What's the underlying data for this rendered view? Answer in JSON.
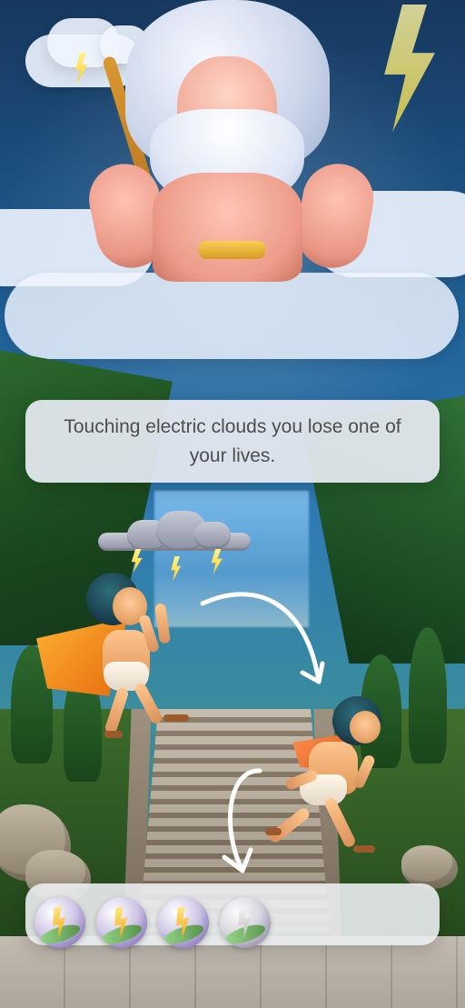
{
  "tutorial": {
    "message": "Touching electric clouds you lose one of your lives."
  },
  "hud": {
    "lives": [
      {
        "state": "full",
        "icon": "life-bolt-icon"
      },
      {
        "state": "full",
        "icon": "life-bolt-icon"
      },
      {
        "state": "full",
        "icon": "life-bolt-icon"
      },
      {
        "state": "used",
        "icon": "life-bolt-icon"
      }
    ]
  },
  "scene": {
    "primary_character": "zeus",
    "hazard": "electric-cloud",
    "player": "greek-hero"
  },
  "colors": {
    "tooltip_bg": "#e4e9f0",
    "text": "#4d4d4d",
    "arrow": "#ffffff",
    "bolt": "#ffd84a"
  }
}
